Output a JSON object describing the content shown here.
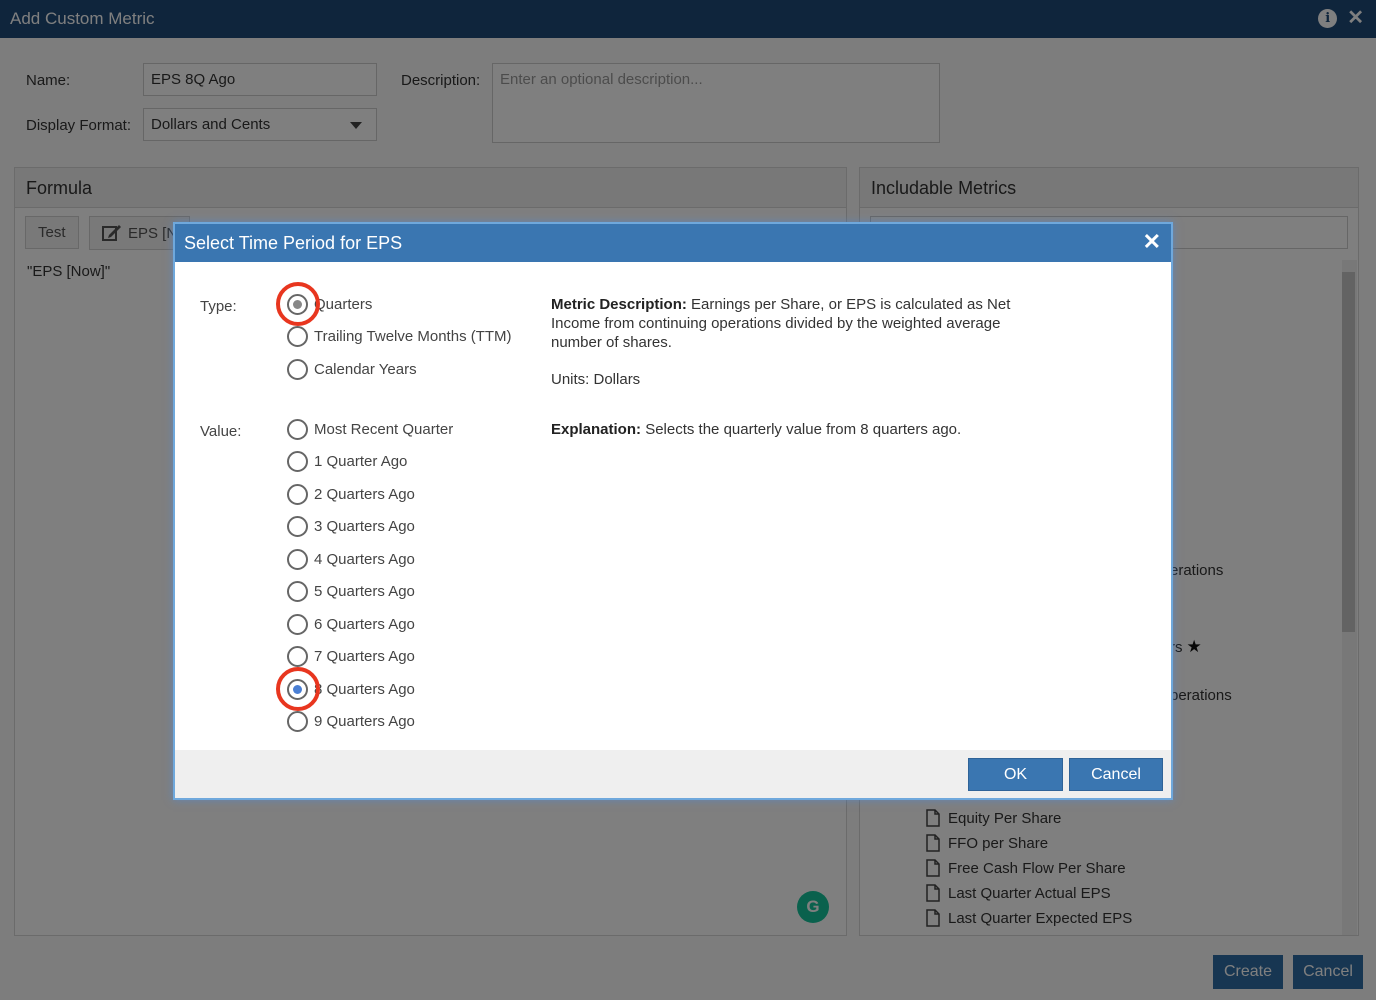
{
  "window": {
    "title": "Add Custom Metric"
  },
  "form": {
    "name_label": "Name:",
    "name_value": "EPS 8Q Ago",
    "display_format_label": "Display Format:",
    "display_format_value": "Dollars and Cents",
    "description_label": "Description:",
    "description_placeholder": "Enter an optional description..."
  },
  "formula_panel": {
    "title": "Formula",
    "test_label": "Test",
    "eps_button_label": "EPS [N",
    "formula_text": "\"EPS [Now]\""
  },
  "metrics_panel": {
    "title": "Includable Metrics",
    "partial_texts": [
      "erations",
      "rs",
      "perations"
    ],
    "items": [
      "Equity Per Share",
      "FFO per Share",
      "Free Cash Flow Per Share",
      "Last Quarter Actual EPS",
      "Last Quarter Expected EPS"
    ]
  },
  "footer": {
    "create_label": "Create",
    "cancel_label": "Cancel"
  },
  "modal": {
    "title": "Select Time Period for EPS",
    "type_label": "Type:",
    "type_options": [
      "Quarters",
      "Trailing Twelve Months (TTM)",
      "Calendar Years"
    ],
    "type_selected": "Quarters",
    "value_label": "Value:",
    "value_options": [
      "Most Recent Quarter",
      "1 Quarter Ago",
      "2 Quarters Ago",
      "3 Quarters Ago",
      "4 Quarters Ago",
      "5 Quarters Ago",
      "6 Quarters Ago",
      "7 Quarters Ago",
      "8 Quarters Ago",
      "9 Quarters Ago"
    ],
    "value_selected": "8 Quarters Ago",
    "metric_description_label": "Metric Description:",
    "metric_description": "Earnings per Share, or EPS is calculated as Net Income from continuing operations divided by the weighted average number of shares.",
    "units": "Units: Dollars",
    "explanation_label": "Explanation:",
    "explanation": "Selects the quarterly value from 8 quarters ago.",
    "ok_label": "OK",
    "cancel_label": "Cancel"
  },
  "colors": {
    "titlebar": "#1e4a78",
    "modal_header": "#3a76b1",
    "highlight": "#e8361f"
  }
}
